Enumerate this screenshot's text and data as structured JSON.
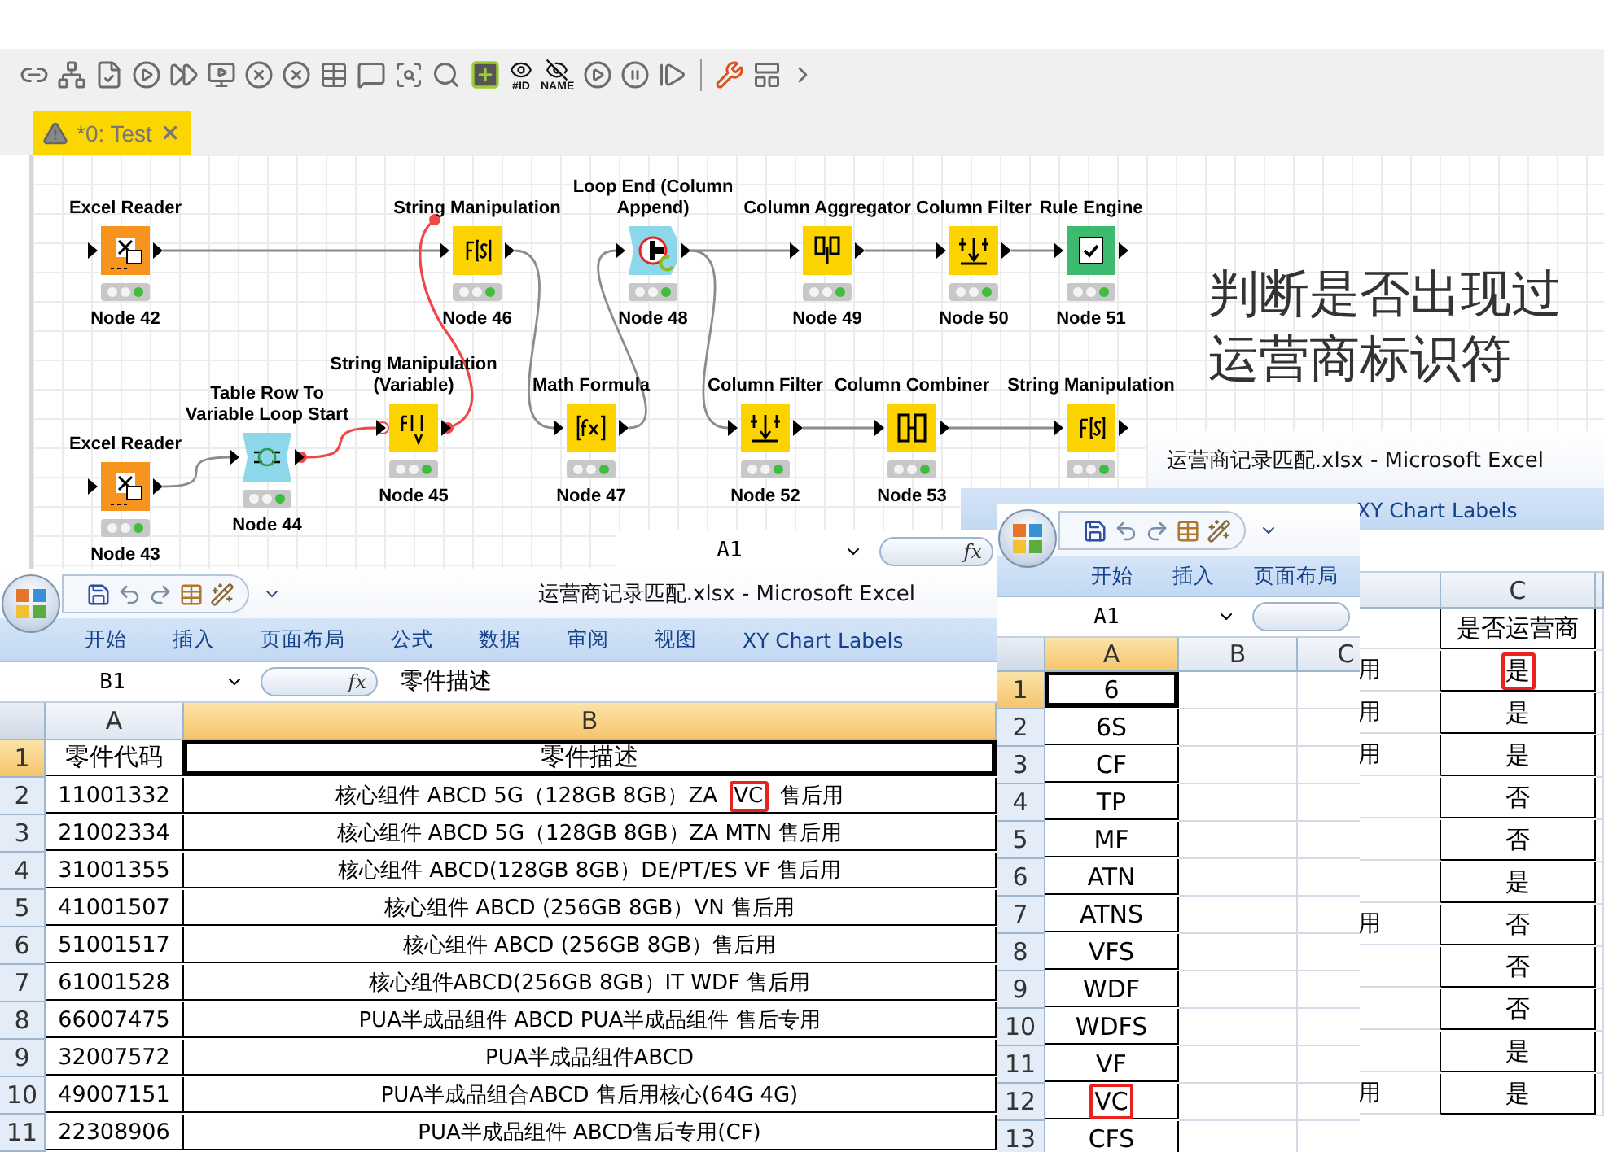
{
  "toolbar": {
    "captions": [
      "#ID",
      "NAME"
    ]
  },
  "editor_tab": {
    "title": "*0: Test",
    "selected": true
  },
  "workflow": {
    "nodes": [
      {
        "title": "Excel Reader",
        "id": "Node 42",
        "kind": "reader",
        "color": "#f7941d"
      },
      {
        "title": "String Manipulation",
        "id": "Node 46",
        "kind": "manipulation",
        "color": "#fcd200"
      },
      {
        "title": "Loop End (Column Append)",
        "id": "Node 48",
        "kind": "loop_end",
        "color": "#8dd7ea"
      },
      {
        "title": "Column Aggregator",
        "id": "Node 49",
        "kind": "aggregator",
        "color": "#fcd200"
      },
      {
        "title": "Column Filter",
        "id": "Node 50",
        "kind": "filter",
        "color": "#fcd200"
      },
      {
        "title": "Rule Engine",
        "id": "Node 51",
        "kind": "rule",
        "color": "#3cba6e"
      },
      {
        "title": "String Manipulation (Variable)",
        "id": "Node 45",
        "kind": "manipulation_variable",
        "color": "#fcd200"
      },
      {
        "title": "Table Row To Variable Loop Start",
        "id": "Node 44",
        "kind": "loop_start",
        "color": "#8dd7ea"
      },
      {
        "title": "Math Formula",
        "id": "Node 47",
        "kind": "math",
        "color": "#fcd200"
      },
      {
        "title": "Column Filter",
        "id": "Node 52",
        "kind": "filter",
        "color": "#fcd200"
      },
      {
        "title": "Column Combiner",
        "id": "Node 53",
        "kind": "combiner",
        "color": "#fcd200"
      },
      {
        "title": "String Manipulation",
        "kind": "manipulation",
        "color": "#fcd200"
      },
      {
        "title": "Excel Reader",
        "id": "Node 43",
        "kind": "reader",
        "color": "#f7941d"
      }
    ],
    "annotation": {
      "lines": [
        "判断是否出现过",
        "运营商标识符"
      ]
    }
  },
  "excel_back": {
    "title": "运营商记录匹配.xlsx - Microsoft Excel",
    "ribbon_tabs": [
      "XY Chart Labels"
    ],
    "name_box": "A1",
    "function_label": "fx",
    "column_header": "C",
    "rows": [
      {
        "value": "是否运营商",
        "boxed": false
      },
      {
        "fragment": "用",
        "value": "是",
        "boxed": true
      },
      {
        "fragment": "用",
        "value": "是",
        "boxed": false
      },
      {
        "fragment": "用",
        "value": "是",
        "boxed": false
      },
      {
        "value": "否",
        "boxed": false
      },
      {
        "value": "否",
        "boxed": false
      },
      {
        "value": "是",
        "boxed": false
      },
      {
        "fragment": "用",
        "value": "否",
        "boxed": false
      },
      {
        "value": "否",
        "boxed": false
      },
      {
        "value": "否",
        "boxed": false
      },
      {
        "value": "是",
        "boxed": false
      },
      {
        "fragment": "用",
        "value": "是",
        "boxed": false
      }
    ]
  },
  "excel_middle": {
    "ribbon_tabs": [
      "开始",
      "插入",
      "页面布局"
    ],
    "name_box": "A1",
    "columns": [
      "A",
      "B",
      "C"
    ],
    "rows": [
      {
        "row": "1",
        "value": "6",
        "selected": true,
        "boxed": false
      },
      {
        "row": "2",
        "value": "6S",
        "selected": false,
        "boxed": false
      },
      {
        "row": "3",
        "value": "CF",
        "selected": false,
        "boxed": false
      },
      {
        "row": "4",
        "value": "TP",
        "selected": false,
        "boxed": false
      },
      {
        "row": "5",
        "value": "MF",
        "selected": false,
        "boxed": false
      },
      {
        "row": "6",
        "value": "ATN",
        "selected": false,
        "boxed": false
      },
      {
        "row": "7",
        "value": "ATNS",
        "selected": false,
        "boxed": false
      },
      {
        "row": "8",
        "value": "VFS",
        "selected": false,
        "boxed": false
      },
      {
        "row": "9",
        "value": "WDF",
        "selected": false,
        "boxed": false
      },
      {
        "row": "10",
        "value": "WDFS",
        "selected": false,
        "boxed": false
      },
      {
        "row": "11",
        "value": "VF",
        "selected": false,
        "boxed": false
      },
      {
        "row": "12",
        "value": "VC",
        "selected": false,
        "boxed": true
      },
      {
        "row": "13",
        "value": "CFS",
        "selected": false,
        "boxed": false
      }
    ]
  },
  "excel_front": {
    "title": "运营商记录匹配.xlsx - Microsoft Excel",
    "ribbon_tabs": [
      "开始",
      "插入",
      "页面布局",
      "公式",
      "数据",
      "审阅",
      "视图",
      "XY Chart Labels"
    ],
    "name_box": "B1",
    "function_label": "fx",
    "formula": "零件描述",
    "columns": [
      "A",
      "B"
    ],
    "rows": [
      {
        "row": "1",
        "code": "零件代码",
        "selected": true,
        "parts": [
          {
            "text": "零件描述",
            "boxed": false
          }
        ]
      },
      {
        "row": "2",
        "code": "11001332",
        "selected": false,
        "parts": [
          {
            "text": "核心组件 ABCD 5G（128GB 8GB）ZA ",
            "boxed": false
          },
          {
            "text": "VC",
            "boxed": true
          },
          {
            "text": " 售后用",
            "boxed": false
          }
        ]
      },
      {
        "row": "3",
        "code": "21002334",
        "selected": false,
        "parts": [
          {
            "text": "核心组件 ABCD 5G（128GB 8GB）ZA MTN 售后用",
            "boxed": false
          }
        ]
      },
      {
        "row": "4",
        "code": "31001355",
        "selected": false,
        "parts": [
          {
            "text": "核心组件 ABCD(128GB 8GB）DE/PT/ES VF 售后用",
            "boxed": false
          }
        ]
      },
      {
        "row": "5",
        "code": "41001507",
        "selected": false,
        "parts": [
          {
            "text": "核心组件 ABCD (256GB 8GB）VN 售后用",
            "boxed": false
          }
        ]
      },
      {
        "row": "6",
        "code": "51001517",
        "selected": false,
        "parts": [
          {
            "text": "核心组件 ABCD (256GB 8GB）售后用",
            "boxed": false
          }
        ]
      },
      {
        "row": "7",
        "code": "61001528",
        "selected": false,
        "parts": [
          {
            "text": "核心组件ABCD(256GB 8GB）IT WDF 售后用",
            "boxed": false
          }
        ]
      },
      {
        "row": "8",
        "code": "66007475",
        "selected": false,
        "parts": [
          {
            "text": "PUA半成品组件 ABCD PUA半成品组件 售后专用",
            "boxed": false
          }
        ]
      },
      {
        "row": "9",
        "code": "32007572",
        "selected": false,
        "parts": [
          {
            "text": "PUA半成品组件ABCD",
            "boxed": false
          }
        ]
      },
      {
        "row": "10",
        "code": "49007151",
        "selected": false,
        "parts": [
          {
            "text": "PUA半成品组合ABCD 售后用核心(64G 4G)",
            "boxed": false
          }
        ]
      },
      {
        "row": "11",
        "code": "22308906",
        "selected": false,
        "parts": [
          {
            "text": "PUA半成品组件 ABCD售后专用(CF)",
            "boxed": false
          }
        ]
      }
    ]
  }
}
